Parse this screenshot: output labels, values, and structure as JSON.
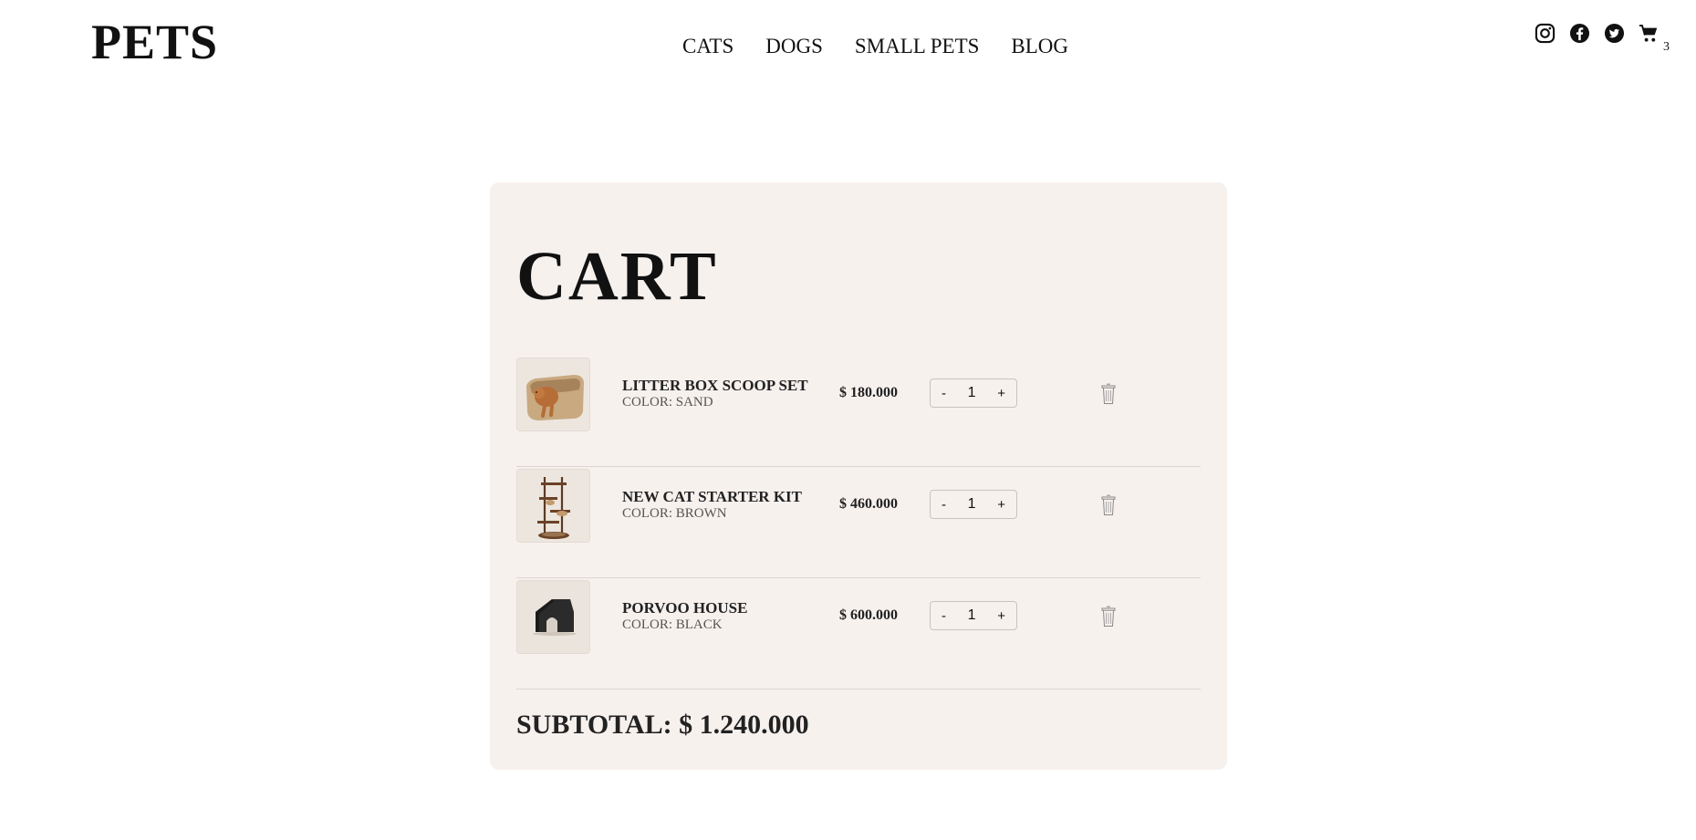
{
  "header": {
    "logo": "PETS",
    "nav": [
      "CATS",
      "DOGS",
      "SMALL PETS",
      "BLOG"
    ],
    "icons": [
      "instagram-icon",
      "facebook-icon",
      "twitter-icon",
      "cart-icon"
    ],
    "cart_count": "3"
  },
  "cart": {
    "title": "CART",
    "items": [
      {
        "name": "LITTER BOX SCOOP SET",
        "color": "COLOR: SAND",
        "price": "$ 180.000",
        "qty": "1",
        "minus": "-",
        "plus": "+"
      },
      {
        "name": "NEW CAT STARTER KIT",
        "color": "COLOR: BROWN",
        "price": "$ 460.000",
        "qty": "1",
        "minus": "-",
        "plus": "+"
      },
      {
        "name": "PORVOO HOUSE",
        "color": "COLOR: BLACK",
        "price": "$ 600.000",
        "qty": "1",
        "minus": "-",
        "plus": "+"
      }
    ],
    "subtotal": "SUBTOTAL: $ 1.240.000"
  },
  "colors": {
    "panel_bg": "#f7f1ee",
    "text": "#111111"
  }
}
